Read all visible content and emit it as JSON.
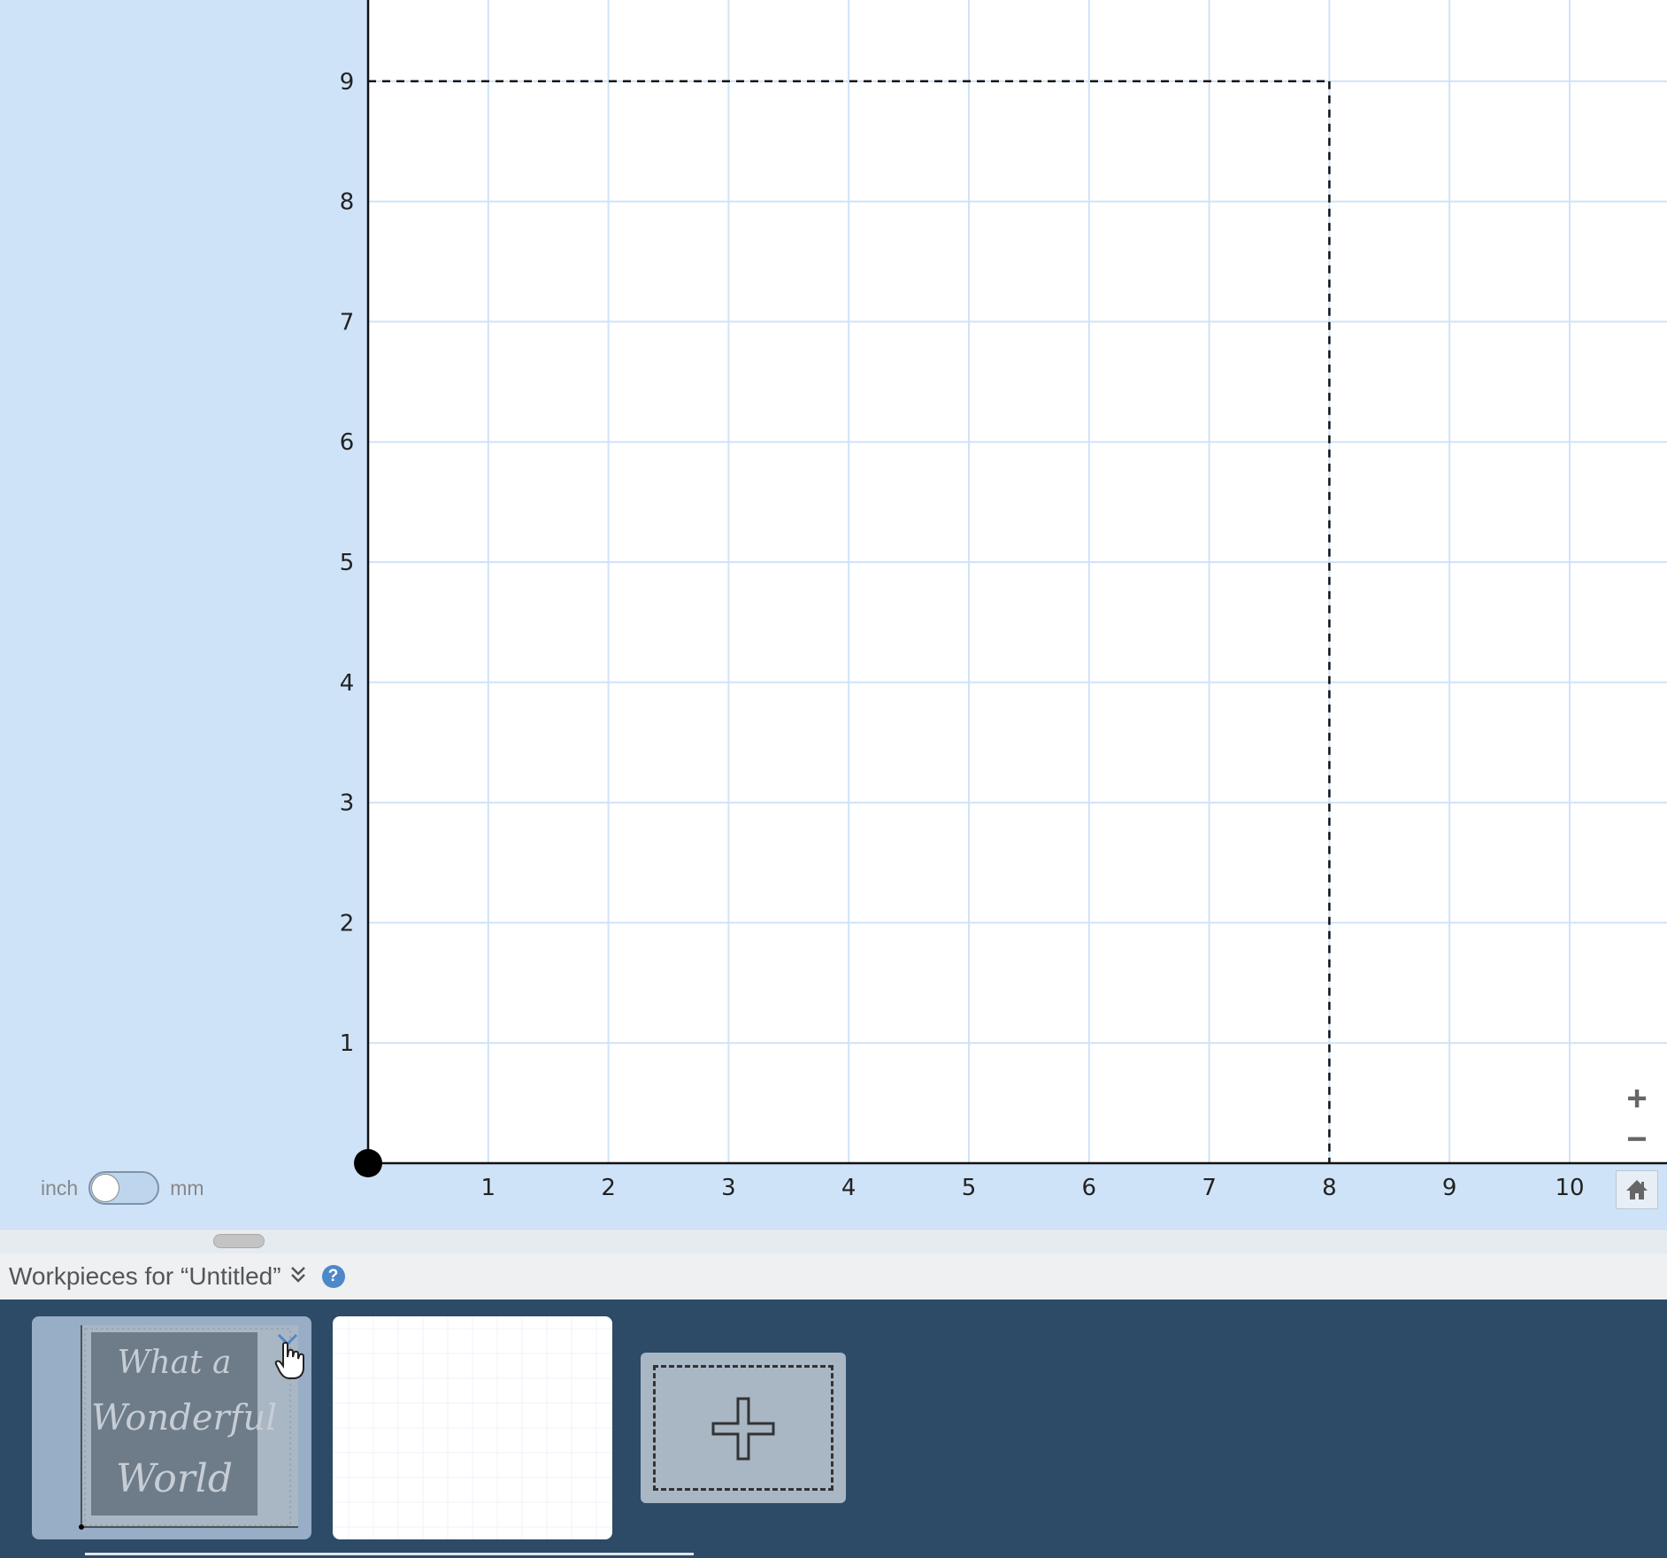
{
  "canvas": {
    "x_axis_labels": [
      "1",
      "2",
      "3",
      "4",
      "5",
      "6",
      "7",
      "8",
      "9",
      "10"
    ],
    "y_axis_labels": [
      "1",
      "2",
      "3",
      "4",
      "5",
      "6",
      "7",
      "8",
      "9"
    ],
    "work_area_width": 8,
    "work_area_height": 9
  },
  "units_toggle": {
    "left_label": "inch",
    "right_label": "mm",
    "selected": "inch"
  },
  "zoom": {
    "in_label": "+",
    "out_label": "−"
  },
  "workpieces": {
    "title": "Workpieces for “Untitled”",
    "help_label": "?",
    "thumbnail_1": {
      "art_lines": [
        "What a",
        "Wonderful",
        "World"
      ]
    }
  },
  "colors": {
    "canvas_background": "#cfe3f8",
    "strip_background": "#2d4a66",
    "grid_line": "#cfe3f8",
    "help_icon": "#4d88c9"
  },
  "icons": [
    "chevron-double-down-icon",
    "help-icon",
    "home-icon",
    "plus-icon",
    "minus-icon",
    "hand-cursor-icon",
    "close-icon"
  ]
}
